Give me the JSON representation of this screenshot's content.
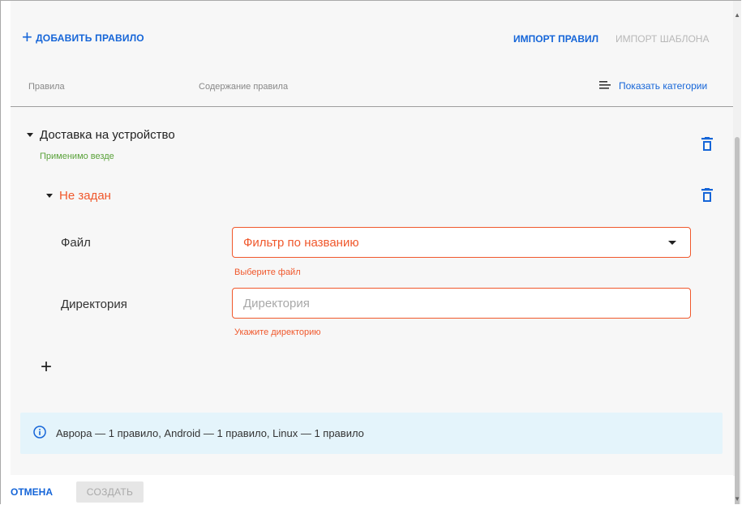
{
  "toolbar": {
    "add_rule_label": "ДОБАВИТЬ ПРАВИЛО",
    "import_rules_label": "ИМПОРТ ПРАВИЛ",
    "import_template_label": "ИМПОРТ ШАБЛОНА"
  },
  "table_header": {
    "rules": "Правила",
    "rule_content": "Содержание правила",
    "show_categories": "Показать категории"
  },
  "rule_group": {
    "title": "Доставка на устройство",
    "scope": "Применимо везде",
    "sub_rule": {
      "title": "Не задан",
      "file_label": "Файл",
      "file_placeholder": "Фильтр по названию",
      "file_error": "Выберите файл",
      "dir_label": "Директория",
      "dir_placeholder": "Директория",
      "dir_error": "Укажите директорию"
    }
  },
  "info_banner": {
    "text": "Аврора — 1 правило, Android — 1 правило, Linux — 1 правило"
  },
  "footer": {
    "cancel_label": "ОТМЕНА",
    "create_label": "СОЗДАТЬ"
  },
  "colors": {
    "primary": "#1565d8",
    "error": "#f0582c",
    "success": "#5aa23a",
    "info_bg": "#e4f4fb",
    "disabled_bg": "#e6e6e6"
  },
  "icons": {
    "add": "plus-icon",
    "categories": "list-lines-icon",
    "delete": "trash-icon",
    "expand": "caret-down-icon",
    "info": "info-circle-icon"
  }
}
